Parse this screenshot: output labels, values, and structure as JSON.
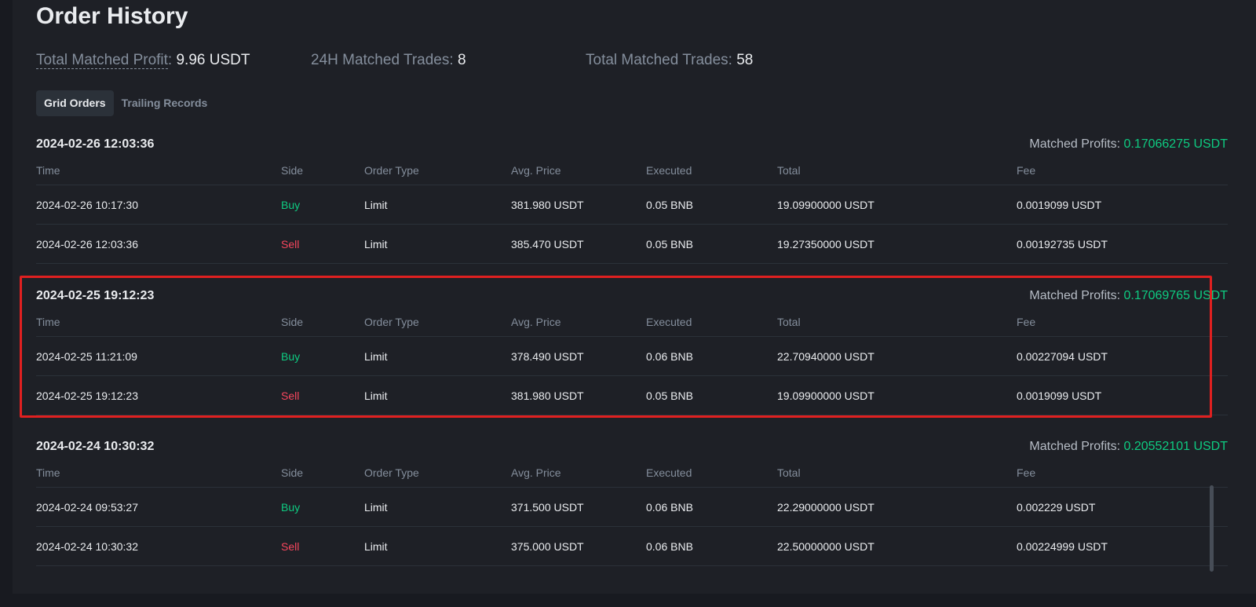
{
  "title": "Order History",
  "stats": {
    "total_profit_label": "Total Matched Profit",
    "total_profit_value": "9.96 USDT",
    "trades_24h_label": "24H Matched Trades: ",
    "trades_24h_value": "8",
    "total_trades_label": "Total Matched Trades: ",
    "total_trades_value": "58"
  },
  "tabs": [
    {
      "label": "Grid Orders",
      "active": true
    },
    {
      "label": "Trailing Records",
      "active": false
    }
  ],
  "columns": [
    "Time",
    "Side",
    "Order Type",
    "Avg. Price",
    "Executed",
    "Total",
    "Fee"
  ],
  "profit_label": "Matched Profits: ",
  "colors": {
    "buy": "#0ecb81",
    "sell": "#f6465d",
    "highlight": "#e02020"
  },
  "groups": [
    {
      "date": "2024-02-26 12:03:36",
      "profit": "0.17066275 USDT",
      "rows": [
        [
          "2024-02-26 10:17:30",
          "Buy",
          "Limit",
          "381.980 USDT",
          "0.05 BNB",
          "19.09900000 USDT",
          "0.0019099 USDT"
        ],
        [
          "2024-02-26 12:03:36",
          "Sell",
          "Limit",
          "385.470 USDT",
          "0.05 BNB",
          "19.27350000 USDT",
          "0.00192735 USDT"
        ]
      ]
    },
    {
      "date": "2024-02-25 19:12:23",
      "profit": "0.17069765 USDT",
      "highlighted": true,
      "rows": [
        [
          "2024-02-25 11:21:09",
          "Buy",
          "Limit",
          "378.490 USDT",
          "0.06 BNB",
          "22.70940000 USDT",
          "0.00227094 USDT"
        ],
        [
          "2024-02-25 19:12:23",
          "Sell",
          "Limit",
          "381.980 USDT",
          "0.05 BNB",
          "19.09900000 USDT",
          "0.0019099 USDT"
        ]
      ]
    },
    {
      "date": "2024-02-24 10:30:32",
      "profit": "0.20552101 USDT",
      "rows": [
        [
          "2024-02-24 09:53:27",
          "Buy",
          "Limit",
          "371.500 USDT",
          "0.06 BNB",
          "22.29000000 USDT",
          "0.002229 USDT"
        ],
        [
          "2024-02-24 10:30:32",
          "Sell",
          "Limit",
          "375.000 USDT",
          "0.06 BNB",
          "22.50000000 USDT",
          "0.00224999 USDT"
        ]
      ]
    }
  ]
}
